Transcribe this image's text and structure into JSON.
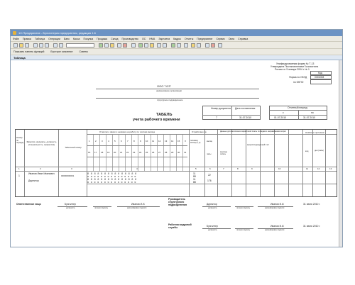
{
  "window": {
    "title": "1С:Предприятие - Бухгалтерия предприятия, редакция 1.6"
  },
  "menu": [
    "Файл",
    "Правка",
    "Таблица",
    "Операции",
    "Банк",
    "Касса",
    "Покупка",
    "Продажа",
    "Склад",
    "Производство",
    "ОС",
    "НМА",
    "Зарплата",
    "Кадры",
    "Отчеты",
    "Предприятие",
    "Сервис",
    "Окна",
    "Справка"
  ],
  "panel": {
    "functions": "Показать панель функций",
    "quick": "Быстрое освоение",
    "tips": "Советы"
  },
  "document_tab": "Таблица",
  "form": {
    "unified_form": "Унифицированная форма № Т-13",
    "approved": "Утверждена Постановлением Госкомстата",
    "approved_date": "России от 5 января 2004 г. № 1",
    "code_label": "Код",
    "okud_label": "Форма по ОКУД",
    "okud_code": "0301008",
    "okpo_label": "по ОКПО",
    "org": "ООО \"123\"",
    "org_caption": "наименование организации",
    "dept_caption": "структурное подразделение",
    "doc_num_label": "Номер документа",
    "doc_date_label": "Дата составления",
    "doc_num": "7",
    "doc_date": "31.07.2010",
    "period_label": "Отчетный период",
    "period_from_label": "с",
    "period_to_label": "по",
    "period_from": "01.07.2010",
    "period_to": "31.07.2010",
    "title1": "ТАБЕЛЬ",
    "title2": "учета рабочего времени"
  },
  "table": {
    "h_num": "Номер по порядку",
    "h_name": "Фамилия, инициалы, должность (специальность, профессия)",
    "h_tab": "Табельный номер",
    "h_marks": "Отметки о явках и неявках на работу по числам месяца",
    "h_worked": "Отработано за",
    "h_half": "половину месяца (I, II)",
    "h_month": "месяц",
    "h_days": "дни",
    "h_hours": "часы",
    "h_salary": "Данные для начисления заработной платы по видам и направлениям затрат",
    "h_paycode": "код вида оплаты",
    "h_account": "корреспондирующий счет",
    "h_absence": "Неявки по причинам",
    "h_code": "код",
    "h_days_hours": "дни (часы)",
    "days1": [
      "1",
      "2",
      "3",
      "4",
      "5",
      "6",
      "7",
      "8",
      "9",
      "10",
      "11",
      "12",
      "13",
      "14",
      "15",
      "Х"
    ],
    "days2": [
      "16",
      "17",
      "18",
      "19",
      "20",
      "21",
      "22",
      "23",
      "24",
      "25",
      "26",
      "27",
      "28",
      "29",
      "30",
      "31"
    ],
    "colnums": [
      "1",
      "2",
      "3",
      "4",
      "5",
      "6",
      "7",
      "8",
      "9",
      "10",
      "11",
      "12",
      "13"
    ],
    "row": {
      "num": "1",
      "name": "Иванов Иван Иванович",
      "position": "Директор",
      "tab": "00000000001",
      "half1_days": "11",
      "half1_hours": "88",
      "half2_days": "11",
      "half2_hours": "88",
      "month_days": "22",
      "month_hours": "176"
    }
  },
  "signatures": {
    "responsible": "Ответственное лицо",
    "resp_position": "Бухгалтер",
    "resp_name": "Иванов И.И.",
    "resp_date": "31 июля 2010 г.",
    "head_unit": "Руководитель структурного подразделения",
    "head_position": "Директор",
    "head_name": "Иванов И.И.",
    "head_date": "31 июля 2010 г.",
    "hr": "Работник кадровой службы",
    "hr_position": "Бухгалтер",
    "hr_name": "Иванов И.И.",
    "hr_date": "31 июля 2010 г.",
    "cap_position": "должность",
    "cap_signature": "личная подпись",
    "cap_decode": "расшифровка подписи"
  }
}
